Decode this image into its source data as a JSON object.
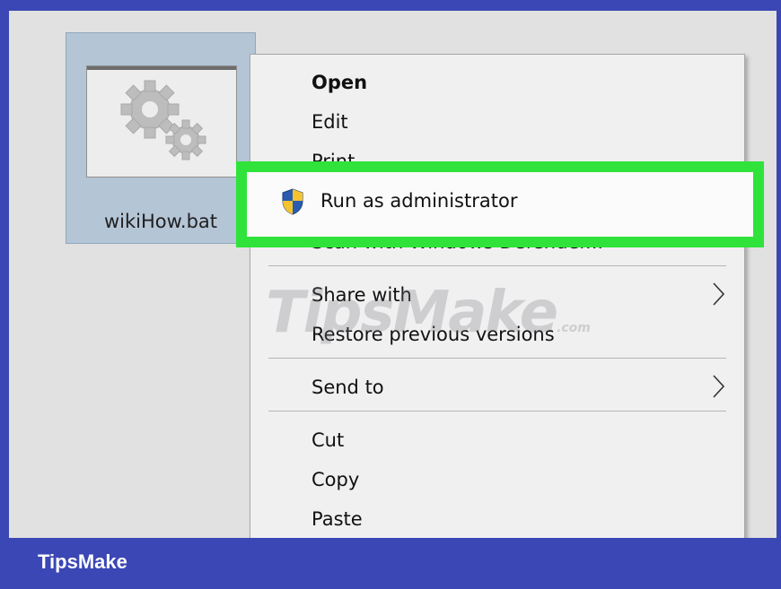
{
  "file": {
    "name": "wikiHow.bat",
    "thumbnail_icon": "gears-icon"
  },
  "context_menu": {
    "items": [
      {
        "label": "Open",
        "bold": true
      },
      {
        "label": "Edit"
      },
      {
        "label": "Print"
      },
      {
        "label": "Run as administrator",
        "icon": "uac-shield-icon",
        "highlighted": true
      },
      {
        "label": "Scan with Windows Defender..."
      },
      {
        "label": "Share with",
        "submenu": true
      },
      {
        "label": "Restore previous versions"
      },
      {
        "label": "Send to",
        "submenu": true
      },
      {
        "label": "Cut"
      },
      {
        "label": "Copy"
      },
      {
        "label": "Paste"
      }
    ]
  },
  "colors": {
    "highlight_border": "#2fe33a",
    "frame": "#3b47b4",
    "desktop": "#e1e1e1",
    "selection": "#b4c5d6"
  },
  "watermark": {
    "main": "TipsMake",
    "suffix": ".com"
  },
  "footer": {
    "brand": "TipsMake"
  }
}
